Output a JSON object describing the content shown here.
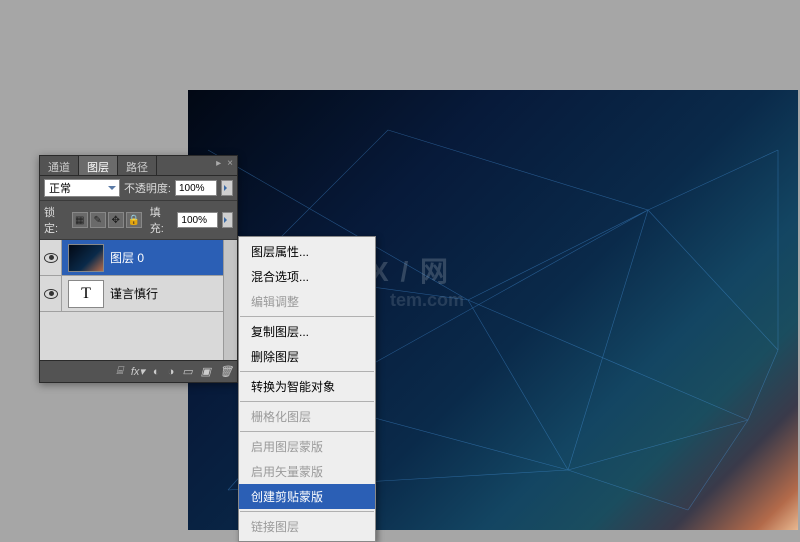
{
  "panel": {
    "tabs": [
      "通道",
      "图层",
      "路径"
    ],
    "active_tab": 1,
    "blend_mode": "正常",
    "opacity_label": "不透明度:",
    "opacity_value": "100%",
    "lock_label": "锁定:",
    "fill_label": "填充:",
    "fill_value": "100%",
    "layers": [
      {
        "name": "图层 0",
        "type": "image",
        "visible": true,
        "selected": true
      },
      {
        "name": "谨言慎行",
        "type": "text",
        "visible": true,
        "selected": false
      }
    ],
    "footer_icons": [
      "link-icon",
      "fx-icon",
      "mask-icon",
      "adjustment-icon",
      "group-icon",
      "new-icon",
      "delete-icon"
    ]
  },
  "context_menu": {
    "items": [
      {
        "label": "图层属性...",
        "enabled": true
      },
      {
        "label": "混合选项...",
        "enabled": true
      },
      {
        "label": "编辑调整",
        "enabled": false
      },
      {
        "sep": true
      },
      {
        "label": "复制图层...",
        "enabled": true
      },
      {
        "label": "删除图层",
        "enabled": true
      },
      {
        "sep": true
      },
      {
        "label": "转换为智能对象",
        "enabled": true
      },
      {
        "sep": true
      },
      {
        "label": "栅格化图层",
        "enabled": false
      },
      {
        "sep": true
      },
      {
        "label": "启用图层蒙版",
        "enabled": false
      },
      {
        "label": "启用矢量蒙版",
        "enabled": false
      },
      {
        "label": "创建剪贴蒙版",
        "enabled": true,
        "selected": true
      },
      {
        "sep": true
      },
      {
        "label": "链接图层",
        "enabled": false
      }
    ]
  },
  "watermark": {
    "line1": "X / 网",
    "line2": "tem.com"
  }
}
